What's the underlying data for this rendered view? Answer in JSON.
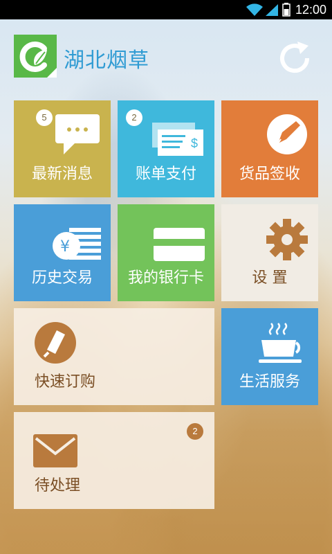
{
  "status_bar": {
    "time": "12:00"
  },
  "header": {
    "title": "湖北烟草",
    "logo": "leaf-logo-icon",
    "refresh": "refresh-icon"
  },
  "tiles": {
    "messages": {
      "label": "最新消息",
      "badge": "5",
      "color": "#c9b34e",
      "icon": "chat-bubble-icon"
    },
    "bill_payment": {
      "label": "账单支付",
      "badge": "2",
      "color": "#3fb8dc",
      "icon": "cheque-icon"
    },
    "goods_receipt": {
      "label": "货品签收",
      "color": "#e27d3a",
      "icon": "sign-pen-icon"
    },
    "history": {
      "label": "历史交易",
      "color": "#4a9ed8",
      "icon": "yen-coin-icon"
    },
    "bank_card": {
      "label": "我的银行卡",
      "color": "#73c35a",
      "icon": "card-icon"
    },
    "settings": {
      "label": "设 置",
      "color": "#f1ece4",
      "icon": "gear-icon"
    },
    "quick_order": {
      "label": "快速订购",
      "color": "#f6eee3",
      "icon": "order-pen-icon"
    },
    "life_service": {
      "label": "生活服务",
      "color": "#4a9ed8",
      "icon": "coffee-cup-icon"
    },
    "todo": {
      "label": "待处理",
      "badge": "2",
      "color": "#f6eee3",
      "icon": "envelope-icon"
    }
  }
}
